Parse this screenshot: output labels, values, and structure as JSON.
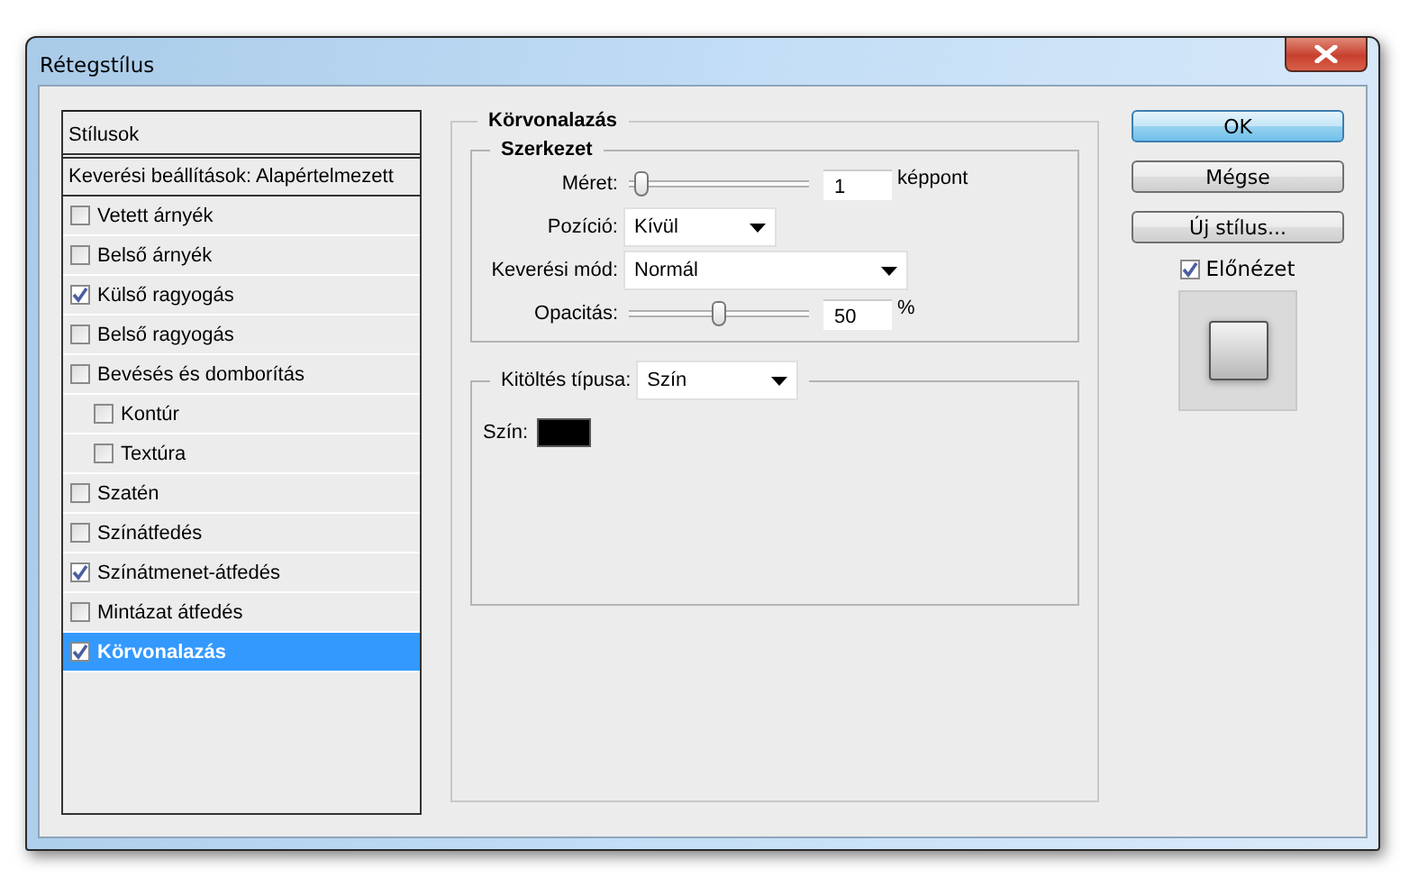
{
  "window": {
    "title": "Rétegstílus"
  },
  "styles_list": {
    "header": "Stílusok",
    "blending_options": "Keverési beállítások: Alapértelmezett",
    "items": [
      {
        "label": "Vetett árnyék",
        "checked": false,
        "selected": false
      },
      {
        "label": "Belső árnyék",
        "checked": false,
        "selected": false
      },
      {
        "label": "Külső ragyogás",
        "checked": true,
        "selected": false
      },
      {
        "label": "Belső ragyogás",
        "checked": false,
        "selected": false
      },
      {
        "label": "Bevésés és domborítás",
        "checked": false,
        "selected": false,
        "children": [
          {
            "label": "Kontúr",
            "checked": false,
            "selected": false
          },
          {
            "label": "Textúra",
            "checked": false,
            "selected": false
          }
        ]
      },
      {
        "label": "Szatén",
        "checked": false,
        "selected": false
      },
      {
        "label": "Színátfedés",
        "checked": false,
        "selected": false
      },
      {
        "label": "Színátmenet-átfedés",
        "checked": true,
        "selected": false
      },
      {
        "label": "Mintázat átfedés",
        "checked": false,
        "selected": false
      },
      {
        "label": "Körvonalazás",
        "checked": true,
        "selected": true
      }
    ]
  },
  "stroke": {
    "title": "Körvonalazás",
    "structure": {
      "title": "Szerkezet",
      "size": {
        "label": "Méret:",
        "level": 0.03,
        "value": "1",
        "unit": "képpont"
      },
      "position": {
        "label": "Pozíció:",
        "value": "Kívül"
      },
      "blend_mode": {
        "label": "Keverési mód:",
        "value": "Normál"
      },
      "opacity": {
        "label": "Opacitás:",
        "level": 0.5,
        "value": "50",
        "unit": "%"
      }
    },
    "fill": {
      "label": "Kitöltés típusa:",
      "value": "Szín",
      "color_label": "Szín:",
      "color": "#000000"
    }
  },
  "buttons": [
    {
      "label": "OK",
      "default": true
    },
    {
      "label": "Mégse",
      "default": false
    },
    {
      "label": "Új stílus...",
      "default": false
    }
  ],
  "preview": {
    "label": "Előnézet",
    "checked": true
  }
}
